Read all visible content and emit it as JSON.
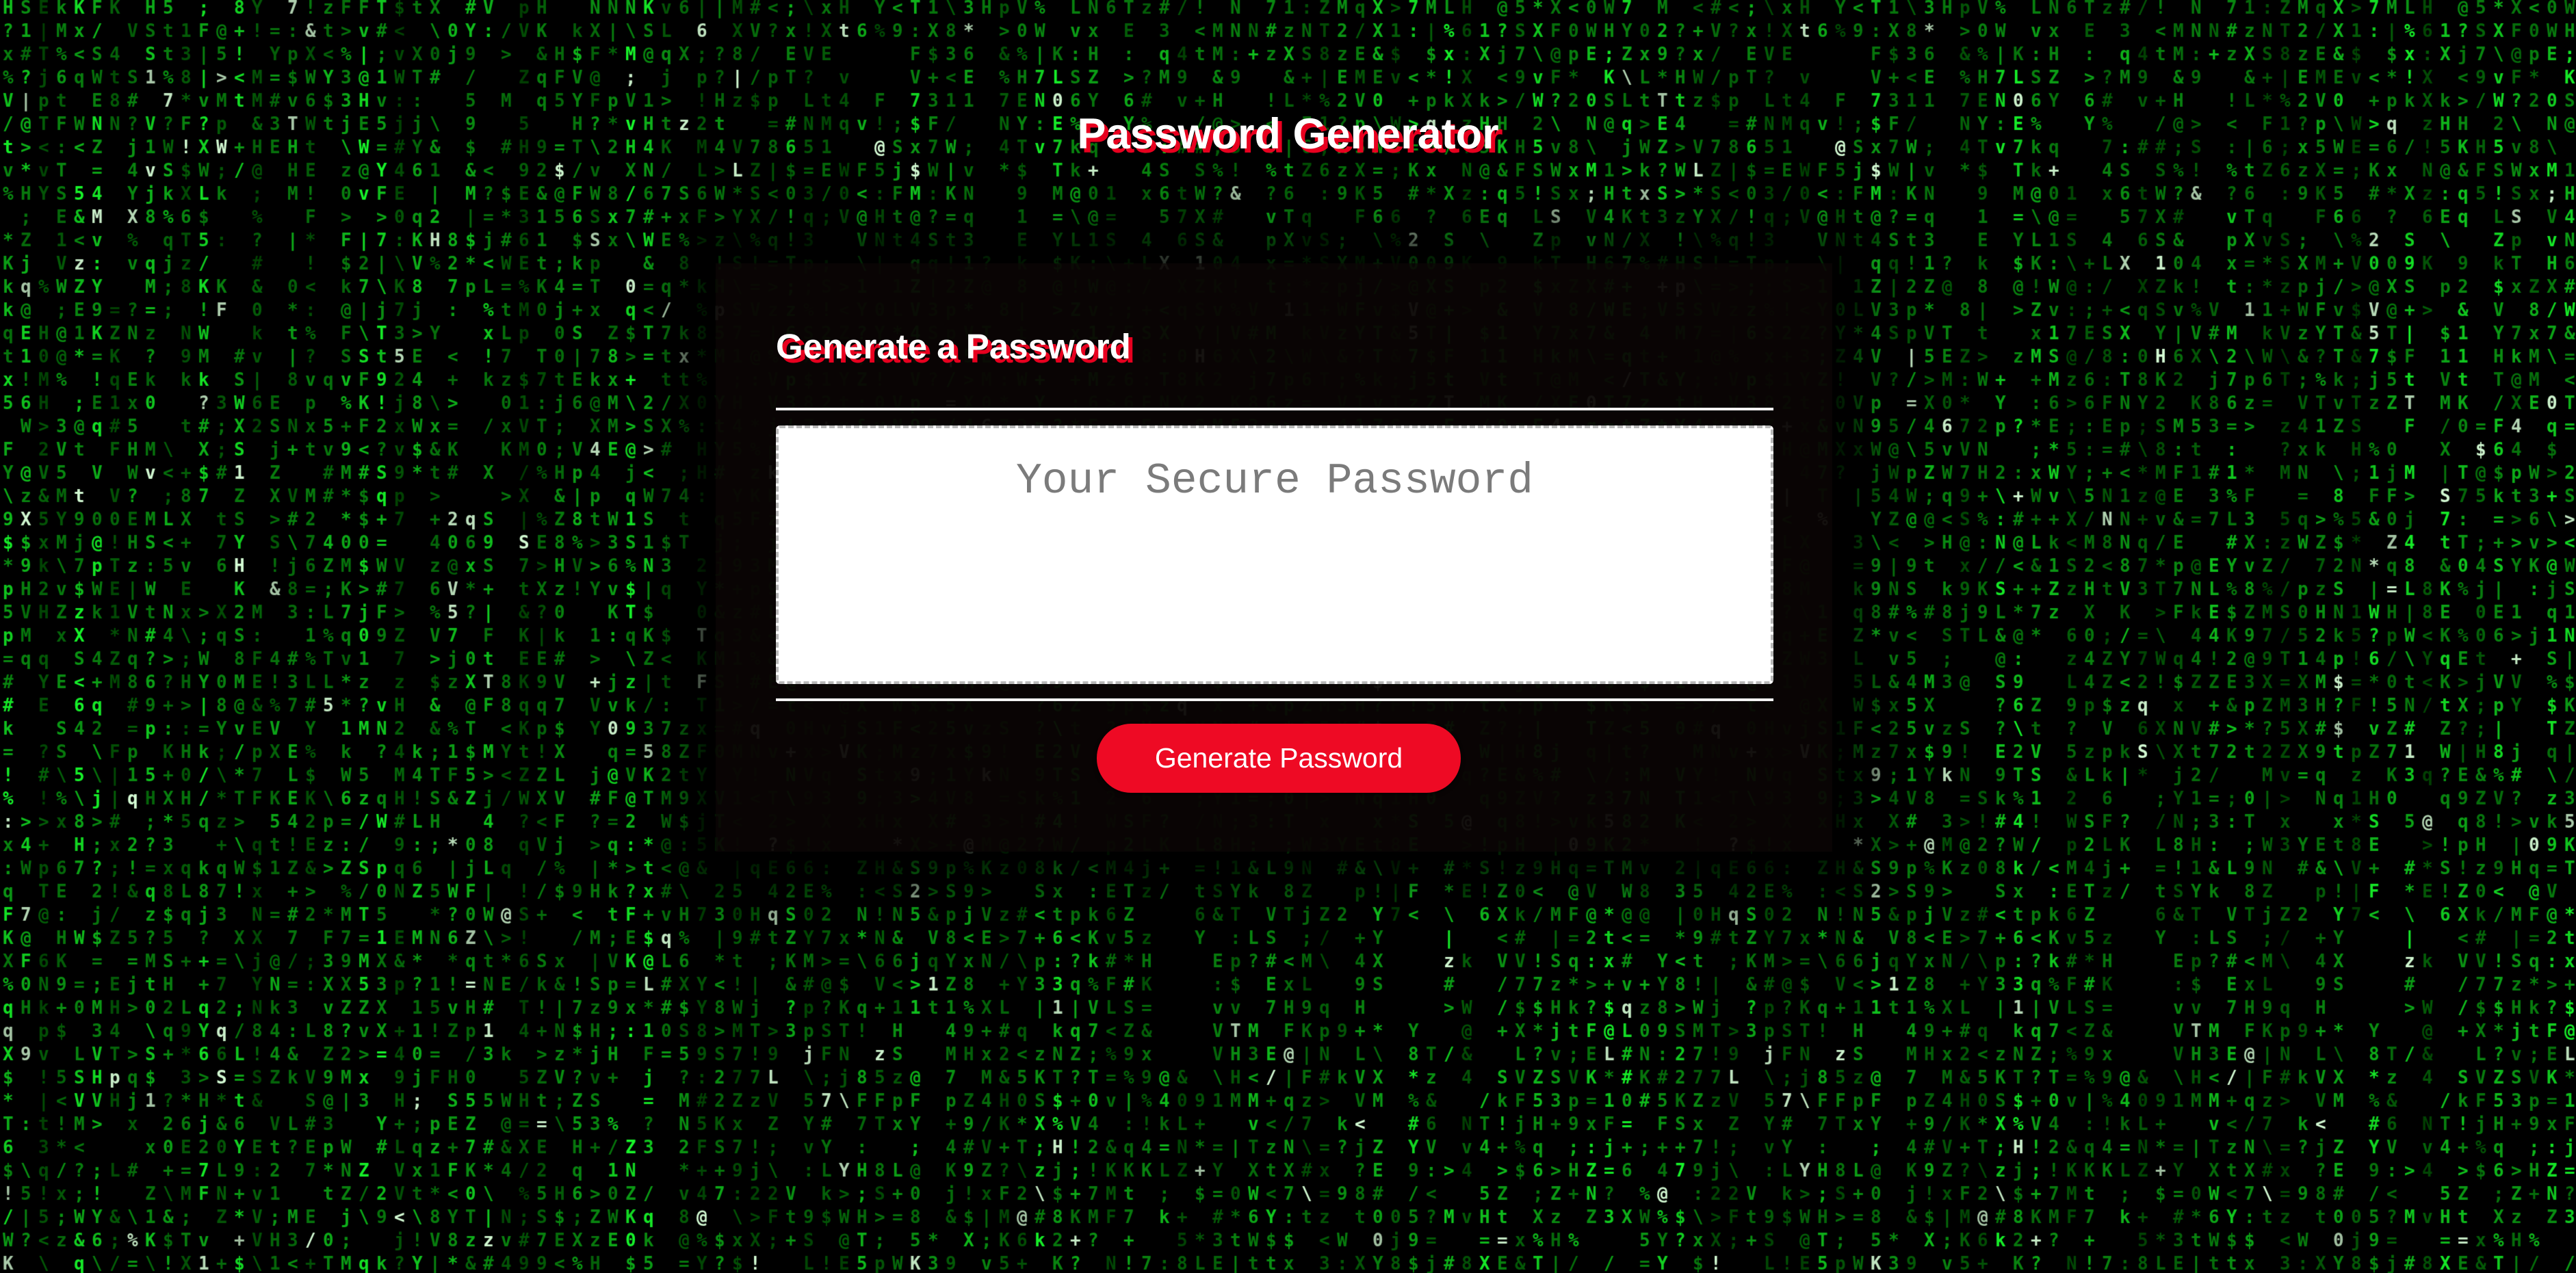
{
  "page": {
    "title": "Password Generator"
  },
  "card": {
    "header": "Generate a Password",
    "password": {
      "placeholder": "Your Secure Password",
      "value": ""
    },
    "generate_button_label": "Generate Password"
  },
  "theme": {
    "background": "#000000",
    "matrix_green": "#2bd13a",
    "accent_red": "#ee0a24",
    "text_white": "#ffffff"
  },
  "background": {
    "style": "matrix-code-rain"
  }
}
